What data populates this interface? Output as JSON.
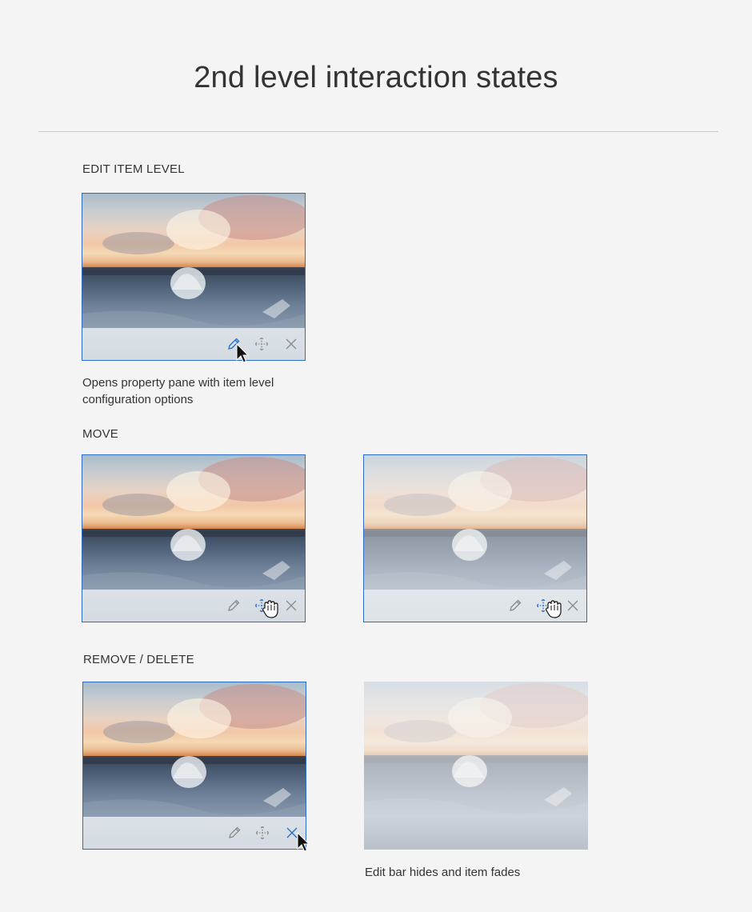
{
  "page": {
    "title": "2nd level interaction states"
  },
  "sections": {
    "edit": {
      "label": "EDIT ITEM LEVEL",
      "description_line1": "Opens property pane with item level",
      "description_line2": "configuration options"
    },
    "move": {
      "label": "MOVE"
    },
    "remove": {
      "label": "REMOVE / DELETE",
      "description": "Edit bar hides and item fades"
    }
  },
  "icons": {
    "edit": "pencil-icon",
    "move": "move-arrows-icon",
    "remove": "close-icon",
    "cursor_pointer": "arrow-cursor-icon",
    "cursor_grab": "hand-grab-cursor-icon"
  },
  "colors": {
    "accent": "#2b6cc4",
    "background": "#f4f4f4",
    "toolbar": "#e8ecf0",
    "icon_idle": "#8a8a8a"
  }
}
